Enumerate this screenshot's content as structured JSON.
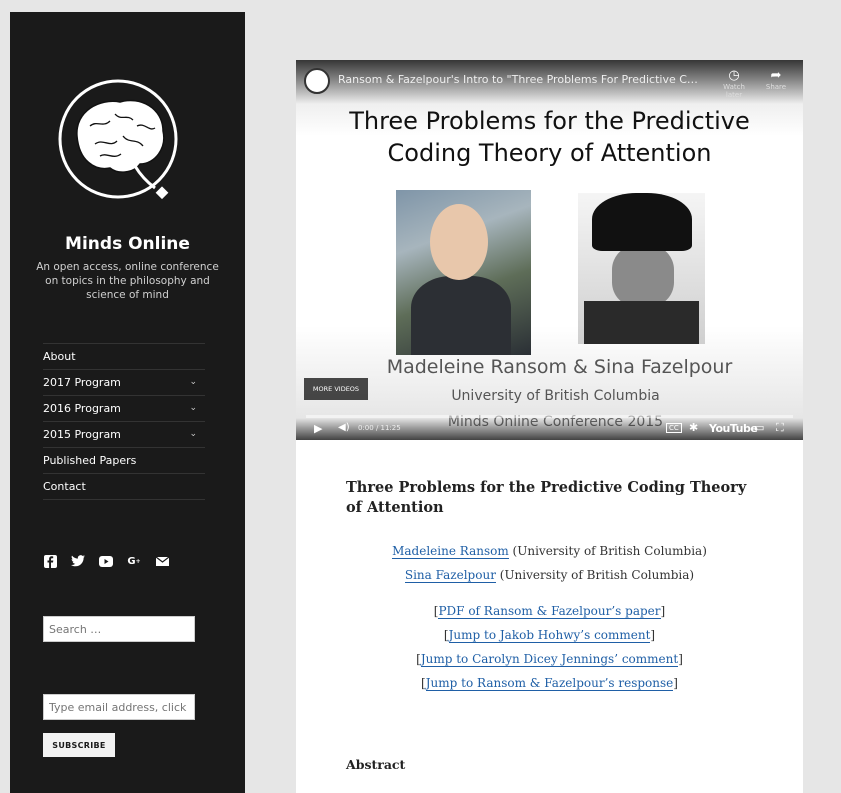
{
  "site": {
    "title": "Minds Online",
    "description": "An open access, online conference on topics in the philosophy and science of mind"
  },
  "menu": [
    {
      "label": "About",
      "has_submenu": false
    },
    {
      "label": "2017 Program",
      "has_submenu": true
    },
    {
      "label": "2016 Program",
      "has_submenu": true
    },
    {
      "label": "2015 Program",
      "has_submenu": true
    },
    {
      "label": "Published Papers",
      "has_submenu": false
    },
    {
      "label": "Contact",
      "has_submenu": false
    }
  ],
  "social_icons": [
    "facebook-icon",
    "twitter-icon",
    "youtube-icon",
    "google-plus-icon",
    "email-icon"
  ],
  "search": {
    "placeholder": "Search …"
  },
  "subscribe": {
    "placeholder": "Type email address, click belo",
    "button_label": "SUBSCRIBE"
  },
  "video": {
    "title": "Ransom & Fazelpour's Intro to \"Three Problems For Predictive Codi...",
    "watch_later_label": "Watch later",
    "share_label": "Share",
    "slide_title": "Three Problems for the Predictive Coding Theory of Attention",
    "slide_names": "Madeleine Ransom & Sina Fazelpour",
    "slide_univ": "University of British Columbia",
    "slide_conf": "Minds Online Conference 2015",
    "more_videos": "MORE VIDEOS",
    "time": "0:00 / 11:25",
    "brand": "YouTube"
  },
  "post": {
    "title": "Three Problems for the Predictive Coding Theory of Attention",
    "authors": [
      {
        "name": "Madeleine Ransom",
        "affiliation": "(University of British Columbia)"
      },
      {
        "name": "Sina Fazelpour",
        "affiliation": "(University of British Columbia)"
      }
    ],
    "links": [
      "PDF of Ransom & Fazelpour’s paper",
      "Jump to Jakob Hohwy’s comment",
      "Jump to Carolyn Dicey Jennings’ comment",
      "Jump to Ransom & Fazelpour’s response"
    ],
    "abstract_heading": "Abstract"
  }
}
